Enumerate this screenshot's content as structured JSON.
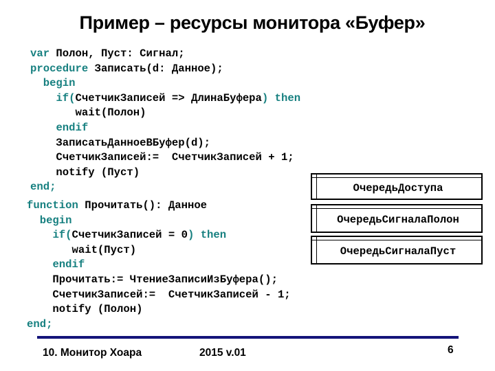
{
  "slide": {
    "title": "Пример – ресурсы монитора «Буфер»"
  },
  "colors": {
    "keyword": "#178080",
    "text": "#000000",
    "footer_rule": "#14147a"
  },
  "code_block_1": {
    "lines": [
      [
        {
          "t": "var",
          "kw": true
        },
        {
          "t": " Полон, Пуст: Сигнал;"
        }
      ],
      [
        {
          "t": "procedure",
          "kw": true
        },
        {
          "t": " Записать(d: Данное);"
        }
      ],
      [
        {
          "t": "  "
        },
        {
          "t": "begin",
          "kw": true
        }
      ],
      [
        {
          "t": "    "
        },
        {
          "t": "if(",
          "kw": true
        },
        {
          "t": "СчетчикЗаписей => ДлинаБуфера"
        },
        {
          "t": ")",
          "kw": true
        },
        {
          "t": " "
        },
        {
          "t": "then",
          "kw": true
        }
      ],
      [
        {
          "t": "       wait(Полон)"
        }
      ],
      [
        {
          "t": "    "
        },
        {
          "t": "endif",
          "kw": true
        }
      ],
      [
        {
          "t": "    ЗаписатьДанноеВБуфер(d);"
        }
      ],
      [
        {
          "t": "    СчетчикЗаписей:=  СчетчикЗаписей + 1;"
        }
      ],
      [
        {
          "t": "    notify (Пуст)"
        }
      ],
      [
        {
          "t": "end;",
          "kw": true
        }
      ]
    ]
  },
  "code_block_2": {
    "lines": [
      [
        {
          "t": "function",
          "kw": true
        },
        {
          "t": " Прочитать(): Данное"
        }
      ],
      [
        {
          "t": "  "
        },
        {
          "t": "begin",
          "kw": true
        }
      ],
      [
        {
          "t": "    "
        },
        {
          "t": "if(",
          "kw": true
        },
        {
          "t": "СчетчикЗаписей = 0"
        },
        {
          "t": ")",
          "kw": true
        },
        {
          "t": " "
        },
        {
          "t": "then",
          "kw": true
        }
      ],
      [
        {
          "t": "       wait(Пуст)"
        }
      ],
      [
        {
          "t": "    "
        },
        {
          "t": "endif",
          "kw": true
        }
      ],
      [
        {
          "t": "    Прочитать:= ЧтениеЗаписиИзБуфера();"
        }
      ],
      [
        {
          "t": "    СчетчикЗаписей:=  СчетчикЗаписей - 1;"
        }
      ],
      [
        {
          "t": "    notify (Полон)"
        }
      ],
      [
        {
          "t": "end;",
          "kw": true
        }
      ]
    ]
  },
  "queues": [
    {
      "label": "ОчередьДоступа"
    },
    {
      "label": "ОчередьСигналаПолон"
    },
    {
      "label": "ОчередьСигналаПуст"
    }
  ],
  "footer": {
    "left": "10. Монитор Хоара",
    "center": "2015 v.01",
    "page_number": "6"
  }
}
